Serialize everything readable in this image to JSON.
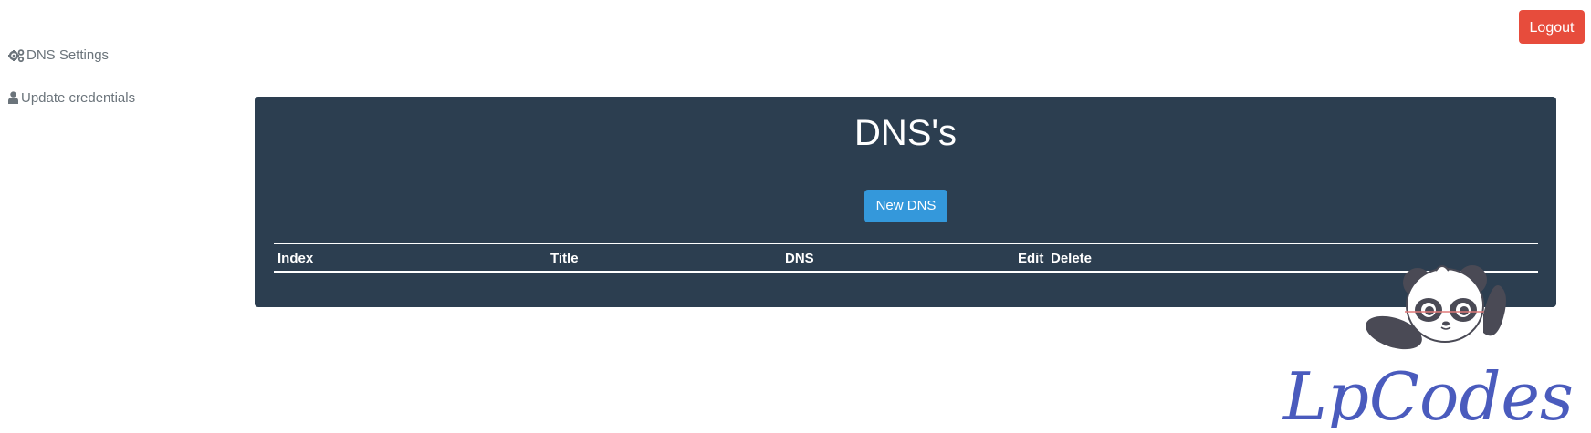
{
  "header": {
    "logout_label": "Logout"
  },
  "sidebar": {
    "items": [
      {
        "label": "DNS Settings",
        "icon": "gears-icon"
      },
      {
        "label": "Update credentials",
        "icon": "user-icon"
      }
    ]
  },
  "panel": {
    "title": "DNS's",
    "new_button_label": "New DNS",
    "table": {
      "columns": [
        "Index",
        "Title",
        "DNS",
        "Edit",
        "Delete"
      ],
      "rows": []
    }
  },
  "watermark": {
    "text": "LpCodes"
  },
  "colors": {
    "logout": "#e74c3c",
    "panel_bg": "#2c3e50",
    "primary_button": "#3498db",
    "sidebar_text": "#6b747b",
    "watermark_text": "#4a5bbd"
  }
}
